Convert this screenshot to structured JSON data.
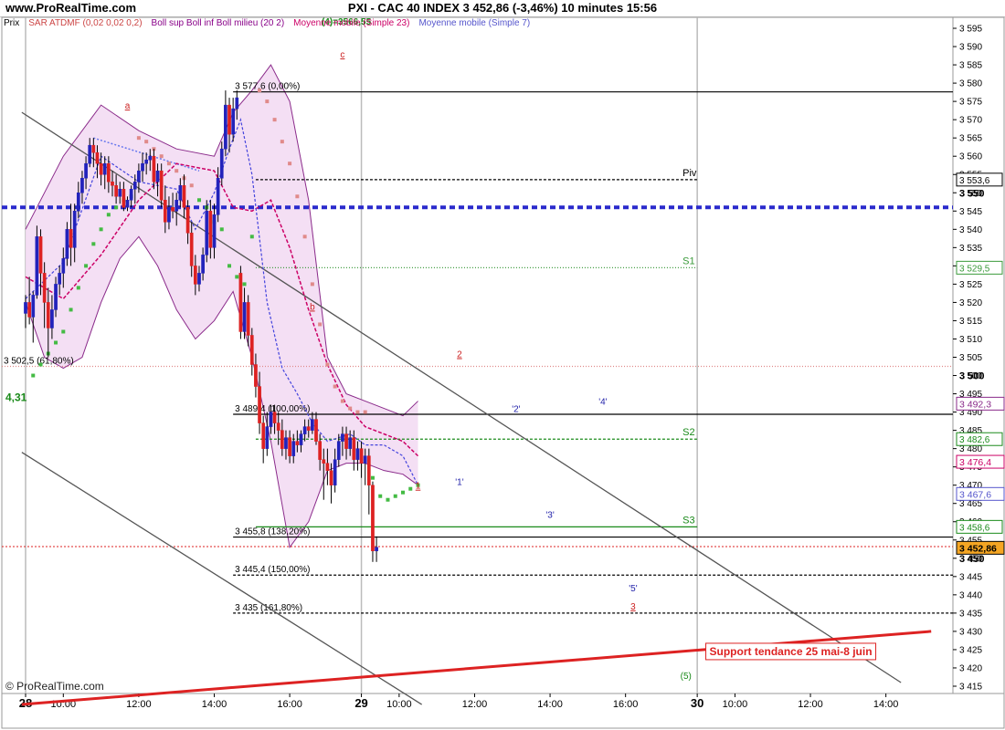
{
  "header": {
    "site": "www.ProRealTime.com",
    "title": "PXI - CAC 40 INDEX    3 452,86 (-3,46%)    10 minutes  15:56"
  },
  "legend": [
    {
      "text": "Prix",
      "color": "#000000"
    },
    {
      "text": "SAR ATDMF (0,02 0,02 0,2)",
      "color": "#cc4444"
    },
    {
      "text": "Boll sup Boll inf Boll milieu (20 2)",
      "color": "#880088"
    },
    {
      "text": "Moyenne mobile (Simple 23)",
      "color": "#cc0066"
    },
    {
      "text": "Moyenne mobile (Simple 7)",
      "color": "#5555cc"
    }
  ],
  "footer": {
    "copyright": "© ProRealTime.com"
  },
  "colors": {
    "up": "#2222bb",
    "down": "#dd2222",
    "boll_fill": "#f3dcf3",
    "boll_line": "#8a2a8a",
    "sar": "#e08a8a",
    "sar_low": "#44bb44",
    "ma23": "#cc0066",
    "ma7": "#4444dd"
  },
  "chart_data": {
    "type": "candlestick",
    "ylim": [
      3413,
      3598
    ],
    "y_ticks": [
      3415,
      3420,
      3425,
      3430,
      3435,
      3440,
      3445,
      3450,
      3455,
      3460,
      3465,
      3470,
      3475,
      3480,
      3485,
      3490,
      3495,
      3500,
      3505,
      3510,
      3515,
      3520,
      3525,
      3530,
      3535,
      3540,
      3545,
      3550,
      3555,
      3560,
      3565,
      3570,
      3575,
      3580,
      3585,
      3590,
      3595
    ],
    "x_labels": [
      {
        "x": 0,
        "label": "28",
        "bold": true
      },
      {
        "x": 10,
        "label": "10:00"
      },
      {
        "x": 30,
        "label": "12:00"
      },
      {
        "x": 50,
        "label": "14:00"
      },
      {
        "x": 70,
        "label": "16:00"
      },
      {
        "x": 89,
        "label": "29",
        "bold": true
      },
      {
        "x": 99,
        "label": "10:00"
      },
      {
        "x": 119,
        "label": "12:00"
      },
      {
        "x": 139,
        "label": "14:00"
      },
      {
        "x": 159,
        "label": "16:00"
      },
      {
        "x": 178,
        "label": "30",
        "bold": true
      },
      {
        "x": 188,
        "label": "10:00"
      },
      {
        "x": 208,
        "label": "12:00"
      },
      {
        "x": 228,
        "label": "14:00"
      }
    ],
    "day_separators": [
      0,
      89,
      178
    ],
    "candles": [
      [
        3517,
        3522,
        3513,
        3520
      ],
      [
        3520,
        3527,
        3514,
        3516
      ],
      [
        3516,
        3523,
        3509,
        3522
      ],
      [
        3522,
        3541,
        3521,
        3538
      ],
      [
        3538,
        3540,
        3522,
        3528
      ],
      [
        3528,
        3531,
        3513,
        3520
      ],
      [
        3520,
        3524,
        3505,
        3513
      ],
      [
        3513,
        3522,
        3510,
        3518
      ],
      [
        3518,
        3527,
        3516,
        3525
      ],
      [
        3525,
        3530,
        3522,
        3528
      ],
      [
        3528,
        3535,
        3524,
        3532
      ],
      [
        3532,
        3542,
        3530,
        3540
      ],
      [
        3540,
        3547,
        3530,
        3535
      ],
      [
        3535,
        3547,
        3531,
        3545
      ],
      [
        3545,
        3553,
        3543,
        3550
      ],
      [
        3550,
        3556,
        3547,
        3554
      ],
      [
        3554,
        3560,
        3551,
        3558
      ],
      [
        3558,
        3565,
        3557,
        3563
      ],
      [
        3563,
        3565,
        3557,
        3561
      ],
      [
        3561,
        3563,
        3554,
        3558
      ],
      [
        3558,
        3561,
        3552,
        3555
      ],
      [
        3555,
        3560,
        3551,
        3558
      ],
      [
        3558,
        3560,
        3550,
        3553
      ],
      [
        3553,
        3556,
        3549,
        3552
      ],
      [
        3552,
        3555,
        3547,
        3549
      ],
      [
        3549,
        3553,
        3547,
        3551
      ],
      [
        3551,
        3553,
        3545,
        3546
      ],
      [
        3546,
        3549,
        3545,
        3548
      ],
      [
        3548,
        3552,
        3546,
        3551
      ],
      [
        3551,
        3555,
        3547,
        3553
      ],
      [
        3553,
        3558,
        3550,
        3556
      ],
      [
        3556,
        3561,
        3553,
        3558
      ],
      [
        3558,
        3561,
        3555,
        3559
      ],
      [
        3559,
        3562,
        3556,
        3560
      ],
      [
        3560,
        3562,
        3551,
        3553
      ],
      [
        3553,
        3558,
        3549,
        3556
      ],
      [
        3556,
        3558,
        3546,
        3548
      ],
      [
        3548,
        3552,
        3539,
        3542
      ],
      [
        3542,
        3549,
        3540,
        3546
      ],
      [
        3546,
        3550,
        3543,
        3545
      ],
      [
        3545,
        3550,
        3541,
        3548
      ],
      [
        3548,
        3554,
        3546,
        3552
      ],
      [
        3552,
        3555,
        3543,
        3546
      ],
      [
        3546,
        3548,
        3536,
        3539
      ],
      [
        3539,
        3542,
        3527,
        3530
      ],
      [
        3530,
        3533,
        3522,
        3525
      ],
      [
        3525,
        3530,
        3523,
        3528
      ],
      [
        3528,
        3535,
        3526,
        3533
      ],
      [
        3533,
        3548,
        3531,
        3545
      ],
      [
        3545,
        3548,
        3532,
        3535
      ],
      [
        3535,
        3547,
        3532,
        3544
      ],
      [
        3544,
        3557,
        3542,
        3554
      ],
      [
        3554,
        3564,
        3552,
        3562
      ],
      [
        3562,
        3578,
        3560,
        3574
      ],
      [
        3574,
        3576,
        3561,
        3566
      ],
      [
        3566,
        3576,
        3564,
        3573
      ],
      [
        3573,
        3578,
        3570,
        3576
      ],
      [
        3528,
        3530,
        3510,
        3512
      ],
      [
        3512,
        3524,
        3510,
        3520
      ],
      [
        3520,
        3522,
        3508,
        3511
      ],
      [
        3511,
        3513,
        3500,
        3503
      ],
      [
        3503,
        3506,
        3494,
        3497
      ],
      [
        3497,
        3501,
        3484,
        3487
      ],
      [
        3487,
        3489,
        3476,
        3480
      ],
      [
        3480,
        3490,
        3478,
        3486
      ],
      [
        3486,
        3492,
        3484,
        3490
      ],
      [
        3490,
        3492,
        3484,
        3487
      ],
      [
        3487,
        3490,
        3481,
        3485
      ],
      [
        3485,
        3488,
        3478,
        3480
      ],
      [
        3480,
        3485,
        3477,
        3483
      ],
      [
        3483,
        3485,
        3476,
        3478
      ],
      [
        3478,
        3484,
        3476,
        3482
      ],
      [
        3482,
        3485,
        3479,
        3481
      ],
      [
        3481,
        3485,
        3479,
        3484
      ],
      [
        3484,
        3488,
        3482,
        3486
      ],
      [
        3486,
        3488,
        3483,
        3485
      ],
      [
        3485,
        3490,
        3484,
        3488
      ],
      [
        3488,
        3490,
        3481,
        3482
      ],
      [
        3482,
        3484,
        3474,
        3477
      ],
      [
        3477,
        3480,
        3466,
        3476
      ],
      [
        3476,
        3480,
        3470,
        3474
      ],
      [
        3474,
        3476,
        3465,
        3470
      ],
      [
        3470,
        3480,
        3468,
        3477
      ],
      [
        3477,
        3484,
        3475,
        3482
      ],
      [
        3482,
        3486,
        3478,
        3484
      ],
      [
        3484,
        3486,
        3477,
        3480
      ],
      [
        3480,
        3485,
        3478,
        3483
      ],
      [
        3483,
        3485,
        3474,
        3477
      ],
      [
        3477,
        3482,
        3474,
        3480
      ],
      [
        3480,
        3482,
        3472,
        3476
      ],
      [
        3476,
        3480,
        3470,
        3478
      ],
      [
        3478,
        3480,
        3462,
        3470
      ],
      [
        3470,
        3471,
        3449,
        3452
      ],
      [
        3452,
        3456,
        3449,
        3453
      ]
    ],
    "sar": [
      [
        2,
        3500,
        "low"
      ],
      [
        4,
        3503,
        "low"
      ],
      [
        6,
        3506,
        "low"
      ],
      [
        8,
        3509,
        "low"
      ],
      [
        10,
        3512,
        "low"
      ],
      [
        12,
        3518,
        "low"
      ],
      [
        14,
        3524,
        "low"
      ],
      [
        16,
        3530,
        "low"
      ],
      [
        18,
        3536,
        "low"
      ],
      [
        20,
        3540,
        "low"
      ],
      [
        22,
        3544,
        "low"
      ],
      [
        24,
        3546,
        "low"
      ],
      [
        26,
        3548,
        "low"
      ],
      [
        28,
        3549,
        "low"
      ],
      [
        30,
        3565,
        "high"
      ],
      [
        32,
        3564,
        "high"
      ],
      [
        34,
        3562,
        "high"
      ],
      [
        36,
        3560,
        "high"
      ],
      [
        38,
        3558,
        "high"
      ],
      [
        40,
        3556,
        "high"
      ],
      [
        42,
        3554,
        "high"
      ],
      [
        44,
        3552,
        "high"
      ],
      [
        46,
        3548,
        "low"
      ],
      [
        48,
        3546,
        "low"
      ],
      [
        50,
        3542,
        "low"
      ],
      [
        52,
        3540,
        "low"
      ],
      [
        54,
        3530,
        "low"
      ],
      [
        56,
        3527,
        "low"
      ],
      [
        58,
        3525,
        "low"
      ],
      [
        60,
        3538,
        "low"
      ],
      [
        62,
        3578,
        "high"
      ],
      [
        64,
        3575,
        "high"
      ],
      [
        66,
        3570,
        "high"
      ],
      [
        68,
        3564,
        "high"
      ],
      [
        70,
        3558,
        "high"
      ],
      [
        72,
        3549,
        "high"
      ],
      [
        74,
        3538,
        "high"
      ],
      [
        76,
        3525,
        "high"
      ],
      [
        78,
        3514,
        "high"
      ],
      [
        80,
        3503,
        "high"
      ],
      [
        82,
        3497,
        "high"
      ],
      [
        84,
        3493,
        "high"
      ],
      [
        86,
        3491,
        "high"
      ],
      [
        88,
        3490,
        "high"
      ],
      [
        90,
        3490,
        "high"
      ],
      [
        92,
        3472,
        "low"
      ],
      [
        94,
        3467,
        "low"
      ],
      [
        96,
        3466,
        "low"
      ],
      [
        98,
        3467,
        "low"
      ],
      [
        100,
        3468,
        "low"
      ],
      [
        102,
        3469,
        "low"
      ],
      [
        104,
        3470,
        "low"
      ]
    ],
    "bollinger_upper": [
      [
        0,
        3540
      ],
      [
        10,
        3560
      ],
      [
        20,
        3574
      ],
      [
        30,
        3567
      ],
      [
        40,
        3562
      ],
      [
        50,
        3560
      ],
      [
        55,
        3572
      ],
      [
        60,
        3578
      ],
      [
        65,
        3585
      ],
      [
        70,
        3575
      ],
      [
        75,
        3548
      ],
      [
        80,
        3505
      ],
      [
        85,
        3495
      ],
      [
        90,
        3493
      ],
      [
        95,
        3491
      ],
      [
        100,
        3489
      ],
      [
        104,
        3493
      ]
    ],
    "bollinger_lower": [
      [
        0,
        3520
      ],
      [
        5,
        3505
      ],
      [
        10,
        3502
      ],
      [
        15,
        3505
      ],
      [
        20,
        3520
      ],
      [
        25,
        3532
      ],
      [
        30,
        3538
      ],
      [
        35,
        3530
      ],
      [
        40,
        3518
      ],
      [
        45,
        3510
      ],
      [
        50,
        3515
      ],
      [
        55,
        3523
      ],
      [
        60,
        3505
      ],
      [
        65,
        3482
      ],
      [
        70,
        3453
      ],
      [
        75,
        3460
      ],
      [
        80,
        3474
      ],
      [
        85,
        3476
      ],
      [
        90,
        3476
      ],
      [
        95,
        3474
      ],
      [
        100,
        3473
      ],
      [
        104,
        3470
      ]
    ],
    "ma23": [
      [
        0,
        3527
      ],
      [
        10,
        3521
      ],
      [
        20,
        3533
      ],
      [
        30,
        3548
      ],
      [
        40,
        3558
      ],
      [
        50,
        3556
      ],
      [
        55,
        3546
      ],
      [
        60,
        3545
      ],
      [
        65,
        3548
      ],
      [
        70,
        3535
      ],
      [
        75,
        3518
      ],
      [
        80,
        3503
      ],
      [
        85,
        3492
      ],
      [
        90,
        3486
      ],
      [
        95,
        3484
      ],
      [
        100,
        3482
      ],
      [
        104,
        3478
      ]
    ],
    "ma7": [
      [
        0,
        3521
      ],
      [
        10,
        3531
      ],
      [
        20,
        3560
      ],
      [
        30,
        3553
      ],
      [
        40,
        3551
      ],
      [
        45,
        3540
      ],
      [
        50,
        3550
      ],
      [
        54,
        3562
      ],
      [
        57,
        3570
      ],
      [
        60,
        3555
      ],
      [
        64,
        3520
      ],
      [
        68,
        3502
      ],
      [
        72,
        3495
      ],
      [
        76,
        3487
      ],
      [
        80,
        3482
      ],
      [
        86,
        3484
      ],
      [
        90,
        3481
      ],
      [
        95,
        3481
      ],
      [
        100,
        3478
      ],
      [
        104,
        3470
      ]
    ],
    "sma_dotted_line": [
      [
        18,
        3565
      ],
      [
        46,
        3556
      ]
    ],
    "horizontal_levels": [
      {
        "y": 3577.6,
        "x1": 55,
        "label": "3 577,6 (0,00%)",
        "style": "solid",
        "color": "#000000"
      },
      {
        "y": 3553.6,
        "x1": 61,
        "x2": 178,
        "label": "Piv",
        "box": "3 553,6",
        "style": "dash",
        "color": "#000000"
      },
      {
        "y": 3546,
        "x1": -1,
        "style": "thickdash",
        "color": "#2a2acc"
      },
      {
        "y": 3529.5,
        "x1": 61,
        "x2": 178,
        "label": "S1",
        "box": "3 529,5",
        "style": "dot",
        "color": "#3a9a3a"
      },
      {
        "y": 3502.5,
        "x1": -1,
        "label": "3 502,5 (61,80%)",
        "style": "dot",
        "color": "#e08a8a"
      },
      {
        "y": 3489.4,
        "x1": 55,
        "label": "3 489,4 (100,00%)",
        "style": "solid",
        "color": "#000000"
      },
      {
        "y": 3482.6,
        "x1": 61,
        "x2": 178,
        "label": "S2",
        "box": "3 482,6",
        "style": "dash",
        "color": "#1a8a1a"
      },
      {
        "y": 3458.6,
        "x1": 61,
        "x2": 178,
        "label": "S3",
        "box": "3 458,6",
        "style": "solid",
        "color": "#1a8a1a"
      },
      {
        "y": 3455.8,
        "x1": 55,
        "label": "3 455,8 (138,20%)",
        "style": "solid",
        "color": "#000000"
      },
      {
        "y": 3453.2,
        "x1": -1,
        "style": "reddot",
        "color": "#dd2222"
      },
      {
        "y": 3445.4,
        "x1": 55,
        "label": "3 445,4 (150,00%)",
        "style": "dash",
        "color": "#000000"
      },
      {
        "y": 3435,
        "x1": 55,
        "label": "3 435 (161,80%)",
        "style": "dash",
        "color": "#000000"
      }
    ],
    "price_boxes": [
      {
        "y": 3492.3,
        "text": "3 492,3",
        "color": "#8a2a8a"
      },
      {
        "y": 3476.4,
        "text": "3 476,4",
        "color": "#cc0066"
      },
      {
        "y": 3467.6,
        "text": "3 467,6",
        "color": "#5555cc"
      },
      {
        "y": 3452.86,
        "text": "3 452,86",
        "color": "#000000",
        "bg": "#f5a623"
      }
    ],
    "trendlines": [
      {
        "from": [
          -1,
          3572
        ],
        "to": [
          232,
          3416
        ],
        "color": "#555555"
      },
      {
        "from": [
          -1,
          3479
        ],
        "to": [
          105,
          3410
        ],
        "color": "#555555"
      },
      {
        "from": [
          -1,
          3410
        ],
        "to": [
          240,
          3430
        ],
        "color": "#dd2222",
        "width": 3
      }
    ],
    "annotations": [
      {
        "x": 27,
        "y": 3573,
        "text": "a",
        "color": "#cc2222"
      },
      {
        "x": 76,
        "y": 3518,
        "text": "b",
        "color": "#cc2222"
      },
      {
        "x": 84,
        "y": 3587,
        "text": "c",
        "color": "#cc2222"
      },
      {
        "x": 104,
        "y": 3469,
        "text": "1",
        "color": "#cc2222"
      },
      {
        "x": 115,
        "y": 3505,
        "text": "2",
        "color": "#cc2222"
      },
      {
        "x": 115,
        "y": 3470,
        "text": "'1'",
        "color": "#2222aa"
      },
      {
        "x": 130,
        "y": 3490,
        "text": "'2'",
        "color": "#2222aa"
      },
      {
        "x": 139,
        "y": 3461,
        "text": "'3'",
        "color": "#2222aa"
      },
      {
        "x": 153,
        "y": 3492,
        "text": "'4'",
        "color": "#2222aa"
      },
      {
        "x": 161,
        "y": 3441,
        "text": "'5'",
        "color": "#2222aa"
      },
      {
        "x": 161,
        "y": 3436,
        "text": "3",
        "color": "#cc2222"
      },
      {
        "x": 175,
        "y": 3417,
        "text": "(5)",
        "color": "#1a8a1a"
      },
      {
        "x": 85,
        "y": 3596,
        "text": "(4)=3566,55",
        "color": "#1a8a1a"
      }
    ],
    "side_label": "4,31",
    "support_box": {
      "x": 181,
      "y": 3424,
      "text": "Support tendance 25 mai-8 juin"
    }
  }
}
